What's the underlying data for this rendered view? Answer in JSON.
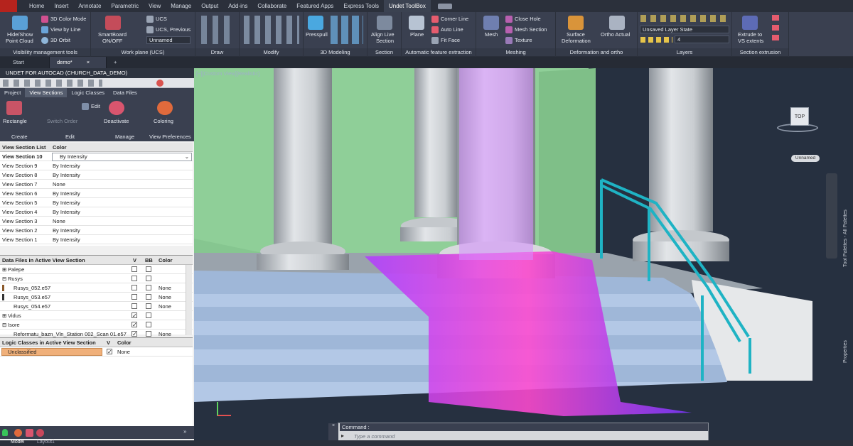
{
  "menu": {
    "tabs": [
      "Home",
      "Insert",
      "Annotate",
      "Parametric",
      "View",
      "Manage",
      "Output",
      "Add-ins",
      "Collaborate",
      "Featured Apps",
      "Express Tools",
      "Undet ToolBox"
    ],
    "active": "Undet ToolBox"
  },
  "ribbon": {
    "visibility": {
      "hide_show": "Hide/Show",
      "point_cloud": "Point Cloud",
      "color_mode": "3D Color Mode",
      "view_by_line": "View by Line",
      "orbit": "3D Orbit",
      "title": "Visibility management tools"
    },
    "workplane": {
      "smartboard": "SmartBoard",
      "onoff": "ON/OFF",
      "ucs": "UCS",
      "ucs_prev": "UCS, Previous",
      "unnamed": "Unnamed",
      "title": "Work plane (UCS)"
    },
    "draw": {
      "title": "Draw"
    },
    "modify": {
      "title": "Modify"
    },
    "modeling": {
      "presspull": "Presspull",
      "title": "3D Modeling"
    },
    "section": {
      "align_live": "Align Live",
      "section": "Section",
      "title": "Section"
    },
    "feature": {
      "plane": "Plane",
      "corner_line": "Corner Line",
      "auto_line": "Auto Line",
      "fit_face": "Fit Face",
      "title": "Automatic feature extraction"
    },
    "meshing": {
      "mesh": "Mesh",
      "close_hole": "Close Hole",
      "mesh_section": "Mesh Section",
      "texture": "Texture",
      "title": "Meshing"
    },
    "deformation": {
      "surface": "Surface",
      "deformation": "Deformation",
      "ortho": "Ortho Actual",
      "title": "Deformation and ortho"
    },
    "layers": {
      "state": "Unsaved Layer State",
      "current": "4",
      "title": "Layers"
    },
    "extrusion": {
      "extrude": "Extrude to",
      "vs": "VS extents",
      "title": "Section extrusion"
    }
  },
  "doctabs": [
    "Start",
    "demo*"
  ],
  "palette": {
    "title": "UNDET FOR AUTOCAD (CHURCH_DATA_DEMO)",
    "tabs": [
      "Project",
      "View Sections",
      "Logic Classes",
      "Data Files"
    ],
    "active_tab": "View Sections",
    "ribbon": {
      "rectangle": "Rectangle",
      "switch_order": "Switch Order",
      "edit": "Edit",
      "deactivate": "Deactivate",
      "coloring": "Coloring",
      "create": "Create",
      "edit_group": "Edit",
      "manage": "Manage",
      "view_prefs": "View Preferences"
    },
    "sections_header": {
      "col1": "View Section List",
      "col2": "Color"
    },
    "sections": [
      {
        "name": "View Section 10",
        "color": "By Intensity",
        "selected": true
      },
      {
        "name": "View Section 9",
        "color": "By Intensity"
      },
      {
        "name": "View Section 8",
        "color": "By Intensity"
      },
      {
        "name": "View Section 7",
        "color": "None"
      },
      {
        "name": "View Section 6",
        "color": "By Intensity"
      },
      {
        "name": "View Section 5",
        "color": "By Intensity"
      },
      {
        "name": "View Section 4",
        "color": "By Intensity"
      },
      {
        "name": "View Section 3",
        "color": "None"
      },
      {
        "name": "View Section 2",
        "color": "By Intensity"
      },
      {
        "name": "View Section 1",
        "color": "By Intensity"
      }
    ],
    "files_header": {
      "col1": "Data Files in Active View Section",
      "v": "V",
      "bb": "BB",
      "color": "Color"
    },
    "files": [
      {
        "name": "Palepe",
        "v": false,
        "bb": false,
        "color": "",
        "group": true
      },
      {
        "name": "Rusys",
        "v": false,
        "bb": false,
        "color": "",
        "group": true
      },
      {
        "name": "Rusys_052.e57",
        "v": false,
        "bb": false,
        "color": "None"
      },
      {
        "name": "Rusys_053.e57",
        "v": false,
        "bb": false,
        "color": "None"
      },
      {
        "name": "Rusys_054.e57",
        "v": false,
        "bb": false,
        "color": "None"
      },
      {
        "name": "Vidus",
        "v": true,
        "bb": false,
        "color": "",
        "group": true
      },
      {
        "name": "Isore",
        "v": true,
        "bb": false,
        "color": "",
        "group": true
      },
      {
        "name": "Reformatu_bazn_Vln_Station 002_Scan 01.e57",
        "v": true,
        "bb": false,
        "color": "None"
      }
    ],
    "classes_header": {
      "col1": "Logic Classes in Active View Section",
      "v": "V",
      "color": "Color"
    },
    "classes": [
      {
        "name": "Unclassified",
        "v": true,
        "color": "None"
      }
    ]
  },
  "viewport": {
    "label": "[−][Custom View][Realistic]",
    "viewcube": "TOP",
    "ucs_label": "Unnamed",
    "side_label_1": "Tool Palettes - All Palettes",
    "side_label_2": "Properties"
  },
  "command": {
    "title": "Command :",
    "placeholder": "Type a command"
  },
  "status": {
    "model": "Model",
    "layout": "Layout1"
  }
}
